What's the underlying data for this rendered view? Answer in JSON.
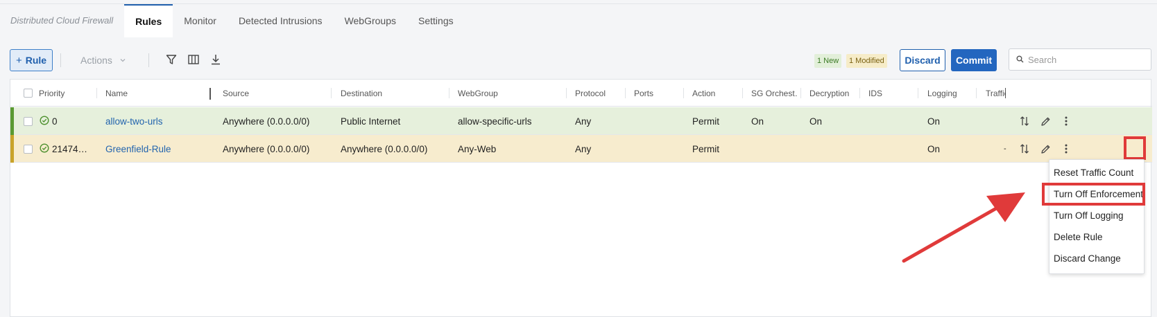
{
  "app": {
    "title": "Distributed Cloud Firewall",
    "tabs": [
      "Rules",
      "Monitor",
      "Detected Intrusions",
      "WebGroups",
      "Settings"
    ],
    "active_tab": "Rules"
  },
  "toolbar": {
    "add_rule_label": "Rule",
    "actions_label": "Actions",
    "badge_new": "1 New",
    "badge_modified": "1 Modified",
    "discard_label": "Discard",
    "commit_label": "Commit",
    "search_placeholder": "Search",
    "icons": [
      "plus-icon",
      "chevron-down-icon",
      "filter-icon",
      "columns-icon",
      "download-icon",
      "search-icon"
    ]
  },
  "table": {
    "columns": [
      "Priority",
      "Name",
      "Source",
      "Destination",
      "WebGroup",
      "Protocol",
      "Ports",
      "Action",
      "SG Orchest…",
      "Decryption",
      "IDS",
      "Logging",
      "Traffic"
    ],
    "rows": [
      {
        "status": "new",
        "priority": "0",
        "name": "allow-two-urls",
        "source": "Anywhere (0.0.0.0/0)",
        "destination": "Public Internet",
        "webgroup": "allow-specific-urls",
        "protocol": "Any",
        "ports": "",
        "action": "Permit",
        "sg_orchestration": "On",
        "decryption": "On",
        "ids": "",
        "logging": "On",
        "traffic": ""
      },
      {
        "status": "modified",
        "priority": "21474…",
        "name": "Greenfield-Rule",
        "source": "Anywhere (0.0.0.0/0)",
        "destination": "Anywhere (0.0.0.0/0)",
        "webgroup": "Any-Web",
        "protocol": "Any",
        "ports": "",
        "action": "Permit",
        "sg_orchestration": "",
        "decryption": "",
        "ids": "",
        "logging": "On",
        "traffic": "-"
      }
    ],
    "row_icons": [
      "check-circle-icon",
      "reorder-icon",
      "edit-pencil-icon",
      "kebab-menu-icon"
    ]
  },
  "context_menu": {
    "items": [
      "Reset Traffic Count",
      "Turn Off Enforcement",
      "Turn Off Logging",
      "Delete Rule",
      "Discard Change"
    ],
    "highlighted": "Turn Off Enforcement"
  },
  "colors": {
    "primary": "#2366bf",
    "new_row": "#e6f0dc",
    "modified_row": "#f7ecce",
    "annotation": "#e03a3a"
  }
}
